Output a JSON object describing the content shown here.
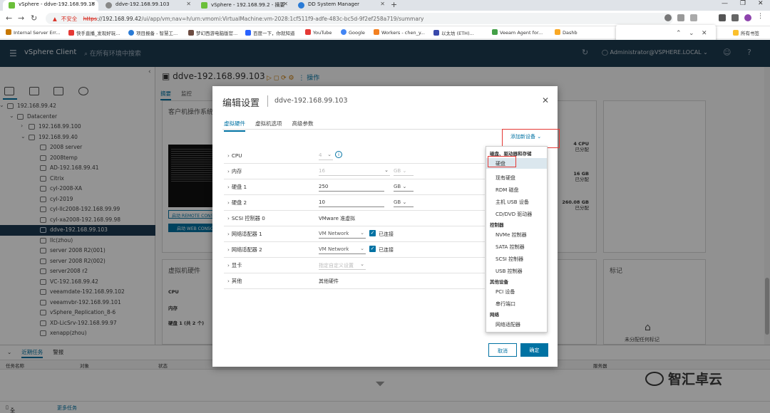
{
  "browser": {
    "tabs": [
      "vSphere - ddve-192.168.99.10",
      "ddve-192.168.99.103",
      "vSphere - 192.168.99.2 - 摘要",
      "DD System Manager"
    ],
    "new_tab": "+",
    "url_warning": "不安全",
    "url_scheme": "https",
    "url_host": "://192.168.99.42",
    "url_path": "/ui/app/vm;nav=h/urn:vmomi:VirtualMachine:vm-2028:1cf511f9-adfe-483c-bc5d-9f2ef258a719/summary",
    "bookmarks": [
      "Internal Server Err...",
      "快手直播_发现好玩...",
      "项目报备 - 智慧工...",
      "梦幻西游电脑版官...",
      "百度一下，你就知道",
      "YouTube",
      "Google",
      "Workers - chen_y...",
      "以太坊 (ETH)...",
      "Veeam Agent for...",
      "Dashb"
    ],
    "all_bookmarks": "所有书签"
  },
  "vsphere": {
    "brand": "vSphere Client",
    "search_placeholder": "在所有环境中搜索",
    "user": "Administrator@VSPHERE.LOCAL"
  },
  "tree": {
    "items": [
      {
        "label": "192.168.99.42"
      },
      {
        "label": "Datacenter"
      },
      {
        "label": "192.168.99.100"
      },
      {
        "label": "192.168.99.40"
      },
      {
        "label": "2008 server"
      },
      {
        "label": "2008temp"
      },
      {
        "label": "AD-192.168.99.41"
      },
      {
        "label": "Citrix"
      },
      {
        "label": "cyl-2008-XA"
      },
      {
        "label": "cyl-2019"
      },
      {
        "label": "cyl-llc2008-192.168.99.99"
      },
      {
        "label": "cyl-xa2008-192.168.99.98"
      },
      {
        "label": "ddve-192.168.99.103"
      },
      {
        "label": "llc(zhou)"
      },
      {
        "label": "server 2008 R2(001)"
      },
      {
        "label": "server 2008 R2(002)"
      },
      {
        "label": "server2008 r2"
      },
      {
        "label": "VC-192.168.99.42"
      },
      {
        "label": "veeamdate-192.168.99.102"
      },
      {
        "label": "veeamvbr-192.168.99.101"
      },
      {
        "label": "vSphere_Replication_8-6"
      },
      {
        "label": "XD-LicSrv-192.168.99.97"
      },
      {
        "label": "xenapp(zhou)"
      }
    ]
  },
  "main": {
    "vm_title": "ddve-192.168.99.103",
    "actions": "操作",
    "subtabs": [
      "摘要",
      "监控"
    ],
    "guest_card": "客户机操作系统",
    "remote_console": "启动 REMOTE CONSOLE",
    "web_console": "启动 WEB CONSOLE",
    "cpu_stat": "4 CPU",
    "cpu_sub": "已分配",
    "mem_stat": "16 GB",
    "mem_sub": "已分配",
    "disk_stat": "260.08 GB",
    "disk_sub": "已分配",
    "hw_card": "虚拟机硬件",
    "hw_cpu": "CPU",
    "hw_mem": "内存",
    "hw_disk": "硬盘 1 (共 2 个)",
    "notes_card": "标记",
    "no_tags": "未分配任何标记"
  },
  "bottom": {
    "tabs": [
      "近期任务",
      "警报"
    ],
    "cols": [
      "任务名称",
      "对象",
      "状态",
      "服务器"
    ],
    "filter_all": "全部",
    "more_tasks": "更多任务"
  },
  "modal": {
    "title": "编辑设置",
    "vm": "ddve-192.168.99.103",
    "tabs": [
      "虚拟硬件",
      "虚拟机选项",
      "高级参数"
    ],
    "add_device": "添加新设备",
    "rows": [
      {
        "name": "CPU",
        "value": "4"
      },
      {
        "name": "内存",
        "value": "16",
        "unit": "GB"
      },
      {
        "name": "硬盘 1",
        "value": "250",
        "unit": "GB"
      },
      {
        "name": "硬盘 2",
        "value": "10",
        "unit": "GB"
      },
      {
        "name": "SCSI 控制器 0",
        "value": "VMware 准虚拟"
      },
      {
        "name": "网络适配器 1",
        "value": "VM Network",
        "check": "已连接"
      },
      {
        "name": "网络适配器 2",
        "value": "VM Network",
        "check": "已连接"
      },
      {
        "name": "显卡",
        "value": "指定自定义设置"
      },
      {
        "name": "其他",
        "value": "其他硬件"
      }
    ],
    "cancel": "取消",
    "ok": "确定"
  },
  "dropdown": {
    "items": [
      {
        "text": "磁盘、驱动器和存储",
        "kind": "group"
      },
      {
        "text": "硬盘",
        "kind": "opt"
      },
      {
        "text": "现有硬盘",
        "kind": "opt"
      },
      {
        "text": "RDM 磁盘",
        "kind": "opt"
      },
      {
        "text": "主机 USB 设备",
        "kind": "opt"
      },
      {
        "text": "CD/DVD 驱动器",
        "kind": "opt"
      },
      {
        "text": "控制器",
        "kind": "group"
      },
      {
        "text": "NVMe 控制器",
        "kind": "opt"
      },
      {
        "text": "SATA 控制器",
        "kind": "opt"
      },
      {
        "text": "SCSI 控制器",
        "kind": "opt"
      },
      {
        "text": "USB 控制器",
        "kind": "opt"
      },
      {
        "text": "其他设备",
        "kind": "group"
      },
      {
        "text": "PCI 设备",
        "kind": "opt"
      },
      {
        "text": "串行端口",
        "kind": "opt"
      },
      {
        "text": "网络",
        "kind": "group"
      },
      {
        "text": "网络适配器",
        "kind": "opt"
      }
    ]
  },
  "watermark": "智汇卓云",
  "colors": {
    "header": "#1d3b50",
    "accent": "#0072a3",
    "highlight_box": "#e53935"
  }
}
